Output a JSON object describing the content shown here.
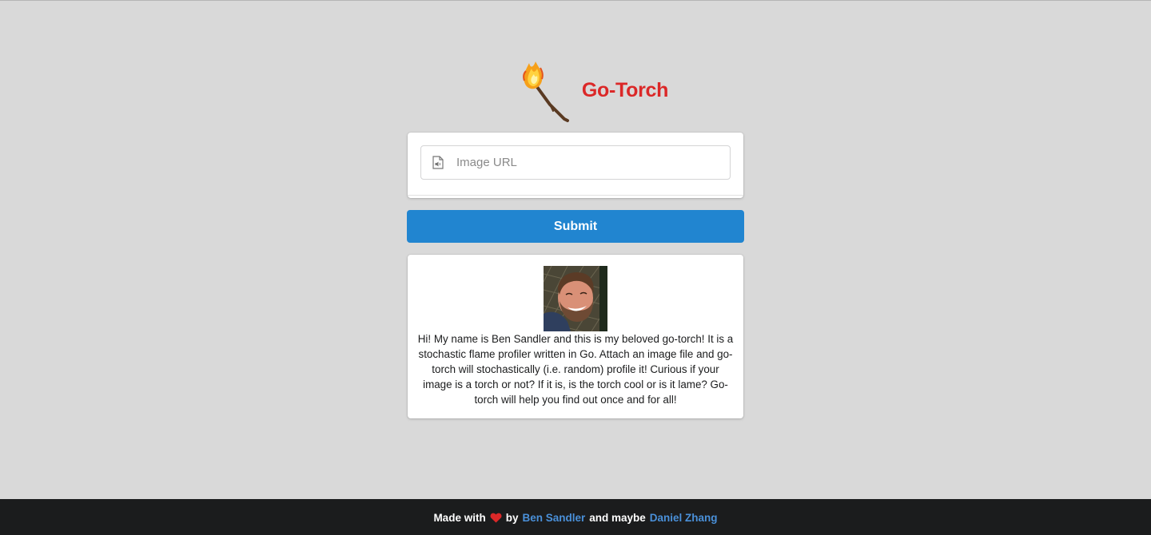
{
  "header": {
    "title": "Go-Torch",
    "logo_icon": "torch-icon"
  },
  "form": {
    "input_placeholder": "Image URL",
    "input_value": "",
    "input_icon": "file-audio-icon",
    "submit_label": "Submit"
  },
  "info": {
    "avatar": "profile-photo",
    "bio": "Hi! My name is Ben Sandler and this is my beloved go-torch! It is a stochastic flame profiler written in Go. Attach an image file and go-torch will stochastically (i.e. random) profile it! Curious if your image is a torch or not? If it is, is the torch cool or is it lame? Go-torch will help you find out once and for all!"
  },
  "footer": {
    "made_with": "Made with",
    "heart_icon": "heart-icon",
    "by": "by",
    "author_1": "Ben Sandler",
    "and_maybe": "and maybe",
    "author_2": "Daniel Zhang"
  },
  "colors": {
    "background": "#d9d9d9",
    "title": "#db2828",
    "primary_button": "#2185d0",
    "footer_bg": "#1b1c1d",
    "footer_link": "#4a90d9",
    "heart": "#db2828"
  }
}
